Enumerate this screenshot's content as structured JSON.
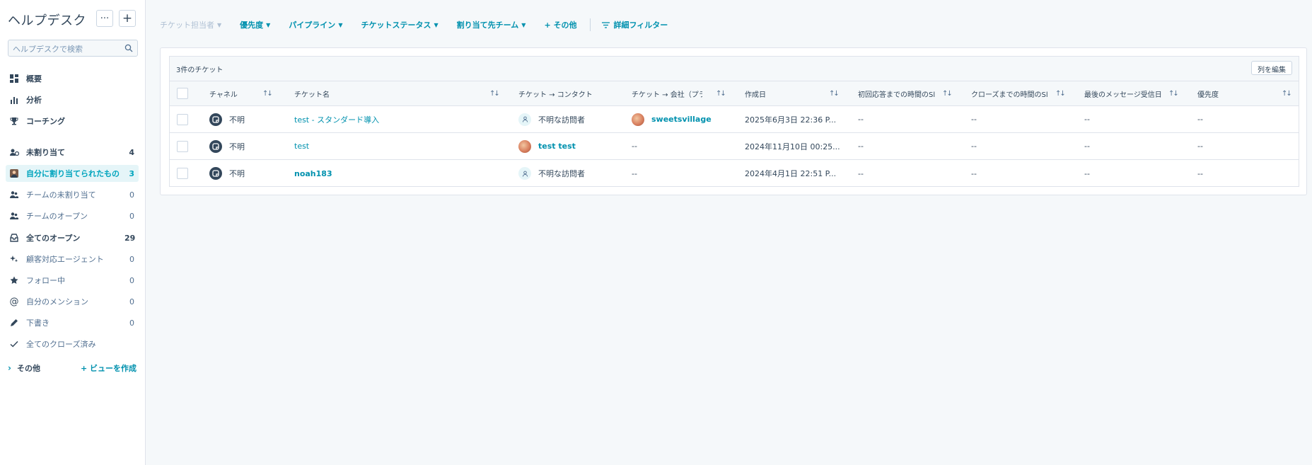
{
  "sidebar": {
    "title": "ヘルプデスク",
    "more_btn": "···",
    "add_btn": "+",
    "search_placeholder": "ヘルプデスクで検索",
    "items": [
      {
        "label": "概要",
        "count": ""
      },
      {
        "label": "分析",
        "count": ""
      },
      {
        "label": "コーチング",
        "count": ""
      },
      {
        "label": "未割り当て",
        "count": "4"
      },
      {
        "label": "自分に割り当てられたもの",
        "count": "3"
      },
      {
        "label": "チームの未割り当て",
        "count": "0"
      },
      {
        "label": "チームのオープン",
        "count": "0"
      },
      {
        "label": "全てのオープン",
        "count": "29"
      },
      {
        "label": "顧客対応エージェント",
        "count": "0"
      },
      {
        "label": "フォロー中",
        "count": "0"
      },
      {
        "label": "自分のメンション",
        "count": "0"
      },
      {
        "label": "下書き",
        "count": "0"
      },
      {
        "label": "全てのクローズ済み",
        "count": ""
      }
    ],
    "more_label": "その他",
    "create_view": "+ ビューを作成"
  },
  "filters": {
    "owner": "チケット担当者",
    "priority": "優先度",
    "pipeline": "パイプライン",
    "status": "チケットステータス",
    "team": "割り当て先チーム",
    "more": "+ その他",
    "advanced": "詳細フィルター"
  },
  "table": {
    "count_label": "3件のチケット",
    "edit_columns": "列を編集",
    "columns": {
      "channel": "チャネル",
      "name": "チケット名",
      "contact": "チケット → コンタクト",
      "company": "チケット → 会社（プラ·",
      "created": "作成日",
      "first_response": "初回応答までの時間のSl",
      "close_time": "クローズまでの時間のSl",
      "last_message": "最後のメッセージ受信日",
      "priority": "優先度"
    },
    "rows": [
      {
        "channel": "不明",
        "name": "test - スタンダード導入",
        "contact": "不明な訪問者",
        "company": "sweetsvillage",
        "created": "2025年6月3日 22:36 P...",
        "first_response": "--",
        "close_time": "--",
        "last_message": "--",
        "priority": "--"
      },
      {
        "channel": "不明",
        "name": "test",
        "contact": "test test",
        "company": "--",
        "created": "2024年11月10日 00:25...",
        "first_response": "--",
        "close_time": "--",
        "last_message": "--",
        "priority": "--"
      },
      {
        "channel": "不明",
        "name": "noah183",
        "contact": "不明な訪問者",
        "company": "--",
        "created": "2024年4月1日 22:51 P...",
        "first_response": "--",
        "close_time": "--",
        "last_message": "--",
        "priority": "--"
      }
    ]
  },
  "colors": {
    "accent": "#0091ae",
    "active_bg": "#e5f5f8",
    "text": "#33475b",
    "border": "#dfe3eb"
  }
}
